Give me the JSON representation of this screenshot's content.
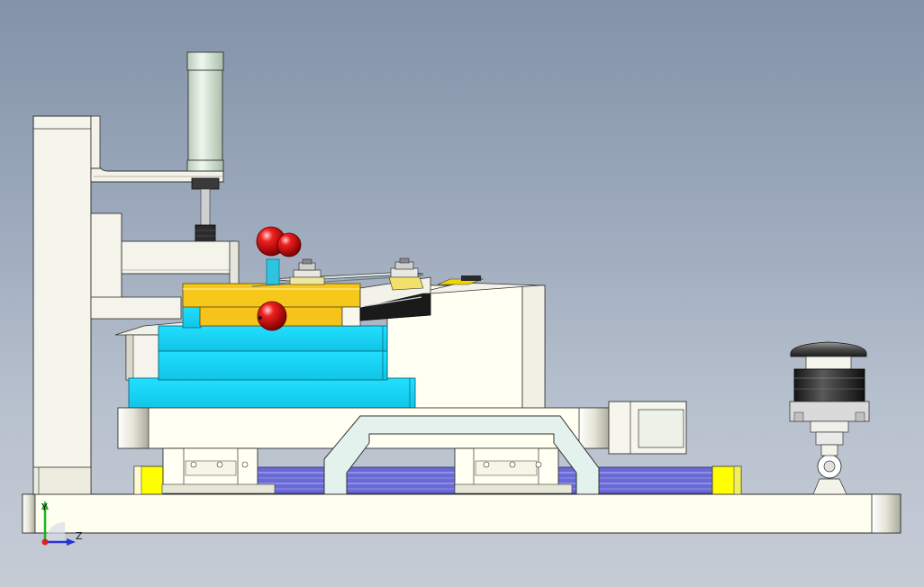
{
  "viewport": {
    "background_top": "#8392a8",
    "background_bottom": "#c6ccd6"
  },
  "triad": {
    "y_label": "Y",
    "z_label": "Z",
    "y_color": "#1fb51f",
    "z_color": "#2433d6",
    "x_color": "#d62424"
  },
  "model": {
    "frame_color": "#f4f4ea",
    "table_color": "#fffff0",
    "cyan_block_color": "#1cd8f6",
    "yellow_plate_color": "#f4c61c",
    "rail_color": "#6e6ed6",
    "yellow_stop_color": "#ffff00",
    "cylinder_color": "#d9e9d9",
    "knob_color": "#e01616",
    "button_cap_color": "#2b2b2b"
  }
}
